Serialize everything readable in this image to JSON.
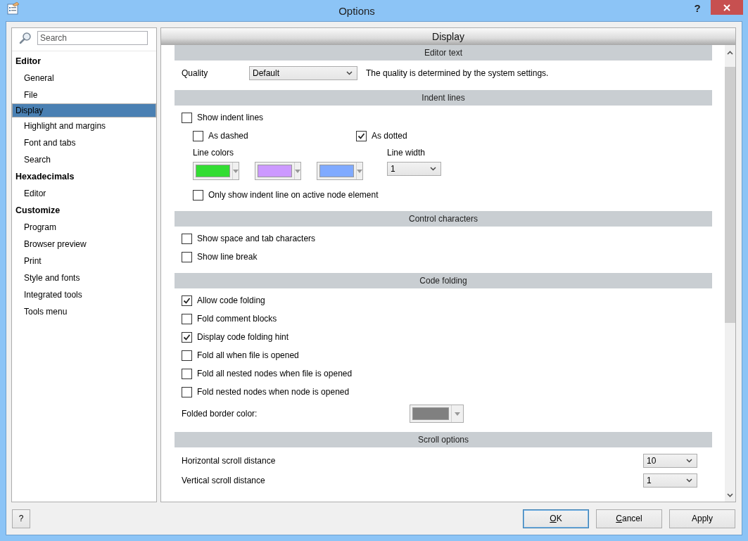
{
  "window": {
    "title": "Options",
    "help": "?"
  },
  "sidebar": {
    "search": {
      "placeholder": "Search"
    },
    "tree": [
      {
        "label": "Editor",
        "selected": false,
        "children": [
          {
            "label": "General",
            "selected": false
          },
          {
            "label": "File",
            "selected": false
          },
          {
            "label": "Display",
            "selected": true
          },
          {
            "label": "Highlight and margins",
            "selected": false
          },
          {
            "label": "Font and tabs",
            "selected": false
          },
          {
            "label": "Search",
            "selected": false
          }
        ]
      },
      {
        "label": "Hexadecimals",
        "selected": false,
        "children": [
          {
            "label": "Editor",
            "selected": false
          }
        ]
      },
      {
        "label": "Customize",
        "selected": false,
        "children": [
          {
            "label": "Program",
            "selected": false
          },
          {
            "label": "Browser preview",
            "selected": false
          },
          {
            "label": "Print",
            "selected": false
          },
          {
            "label": "Style and fonts",
            "selected": false
          },
          {
            "label": "Integrated tools",
            "selected": false
          },
          {
            "label": "Tools menu",
            "selected": false
          }
        ]
      }
    ]
  },
  "panel": {
    "title": "Display",
    "sections": [
      {
        "title": "Editor text",
        "rows": [
          {
            "kind": "select",
            "label": "Quality",
            "value": "Default",
            "note": "The quality is determined by the system settings."
          }
        ]
      },
      {
        "title": "Indent lines",
        "rows": [
          {
            "kind": "checkbox",
            "label": "Show indent lines",
            "checked": false,
            "children": [
              {
                "kind": "pair",
                "items": [
                  {
                    "label": "As dashed",
                    "checked": false
                  },
                  {
                    "label": "As dotted",
                    "checked": true
                  }
                ]
              },
              {
                "kind": "colors",
                "label": "Line colors",
                "swatches": [
                  {
                    "color": "#33dd33"
                  },
                  {
                    "color": "#cc99ff"
                  },
                  {
                    "color": "#80aaff"
                  }
                ],
                "width_label": "Line width",
                "width_value": "1"
              },
              {
                "kind": "checkbox",
                "label": "Only show indent line on active node element",
                "checked": false
              }
            ]
          }
        ]
      },
      {
        "title": "Control characters",
        "rows": [
          {
            "kind": "checkbox",
            "label": "Show space and tab characters",
            "checked": false
          },
          {
            "kind": "checkbox",
            "label": "Show line break",
            "checked": false
          }
        ]
      },
      {
        "title": "Code folding",
        "rows": [
          {
            "kind": "checkbox",
            "label": "Allow code folding",
            "checked": true
          },
          {
            "kind": "checkbox",
            "label": "Fold comment blocks",
            "checked": false
          },
          {
            "kind": "checkbox",
            "label": "Display code folding hint",
            "checked": true
          },
          {
            "kind": "checkbox",
            "label": "Fold all when file is opened",
            "checked": false
          },
          {
            "kind": "checkbox",
            "label": "Fold all nested nodes when file is opened",
            "checked": false
          },
          {
            "kind": "checkbox",
            "label": "Fold nested nodes when node is opened",
            "checked": false
          },
          {
            "kind": "color",
            "label": "Folded border color:",
            "color": "#808080"
          }
        ]
      },
      {
        "title": "Scroll options",
        "rows": [
          {
            "kind": "number",
            "label": "Horizontal scroll distance",
            "value": "10"
          },
          {
            "kind": "number",
            "label": "Vertical scroll distance",
            "value": "1"
          }
        ]
      }
    ]
  },
  "footer": {
    "help": "?",
    "buttons": [
      {
        "label": "OK",
        "default": true,
        "mnemonic": true
      },
      {
        "label": "Cancel",
        "default": false,
        "mnemonic": true
      },
      {
        "label": "Apply",
        "default": false,
        "mnemonic": false
      }
    ]
  }
}
